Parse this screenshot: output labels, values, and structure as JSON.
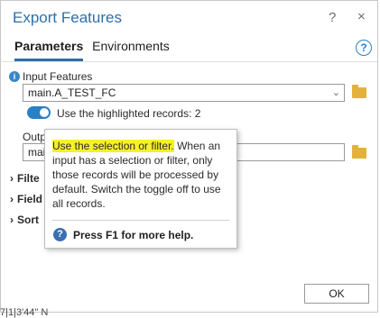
{
  "window": {
    "title": "Export Features",
    "help": "?",
    "close": "×"
  },
  "tabs": [
    {
      "label": "Parameters",
      "active": true
    },
    {
      "label": "Environments",
      "active": false
    }
  ],
  "help_circle": "?",
  "input_features": {
    "info_icon": "i",
    "label": "Input Features",
    "value": "main.A_TEST_FC",
    "toggle_label": "Use the highlighted records: 2"
  },
  "output": {
    "label_visible": "Outp",
    "value_visible": "mai"
  },
  "sections": {
    "filter": "Filte",
    "field": "Field",
    "sort": "Sort"
  },
  "popup": {
    "highlight": "Use the selection or filter.",
    "text": " When an input has a selection or filter, only those records will be processed by default. Switch the toggle off to use all records.",
    "help_icon": "?",
    "help_text": "Press F1 for more help."
  },
  "ok_label": "OK",
  "bottom_partial": "7|1|3'44\" N"
}
